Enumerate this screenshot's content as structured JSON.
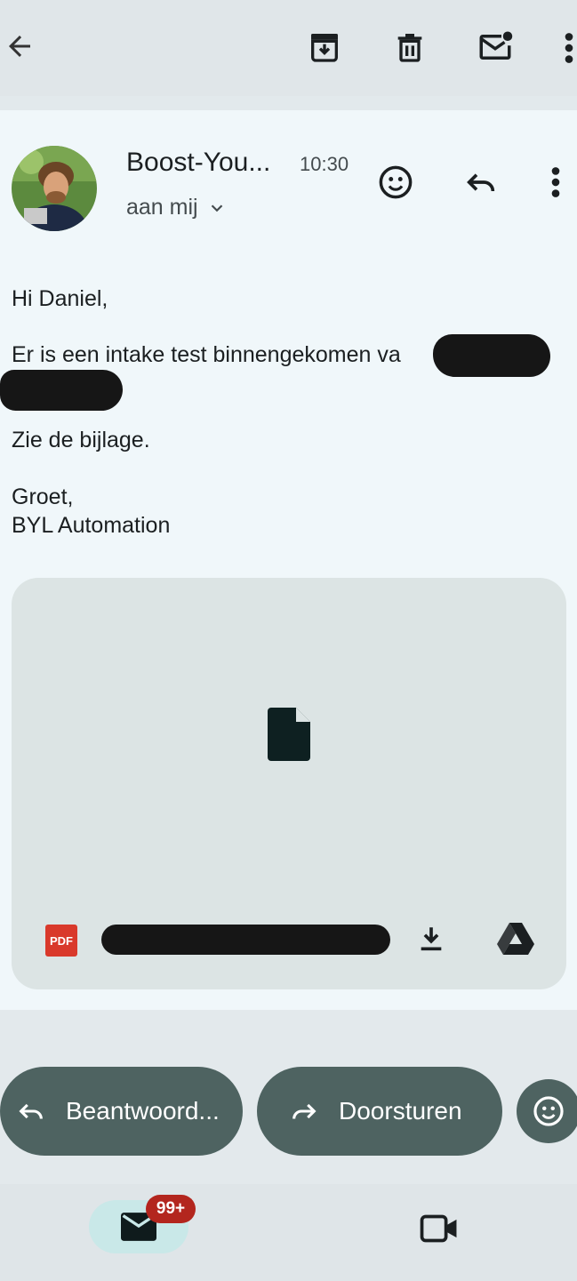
{
  "toolbar": {
    "back_icon": "arrow-left-icon",
    "archive_icon": "archive-icon",
    "delete_icon": "trash-icon",
    "unread_icon": "mark-unread-icon",
    "more_icon": "more-vert-icon"
  },
  "message": {
    "sender": "Boost-You...",
    "time": "10:30",
    "recipient": "aan mij",
    "body": {
      "greeting": "Hi Daniel,",
      "line1": "Er is een intake test binnengekomen va",
      "line3": "Zie de bijlage.",
      "closing": "Groet,",
      "signature": "BYL Automation"
    }
  },
  "attachment": {
    "type_badge": "PDF",
    "file_icon": "file-icon",
    "download_icon": "download-icon",
    "drive_icon": "google-drive-icon"
  },
  "actions": {
    "reply_label": "Beantwoord...",
    "forward_label": "Doorsturen",
    "emoji_icon": "emoji-smile-icon"
  },
  "bottom_nav": {
    "mail_badge": "99+",
    "mail_icon": "mail-icon",
    "meet_icon": "video-camera-icon"
  },
  "colors": {
    "accent_pill": "#4e6361",
    "badge_red": "#b3261e",
    "pdf_red": "#d9392b"
  }
}
